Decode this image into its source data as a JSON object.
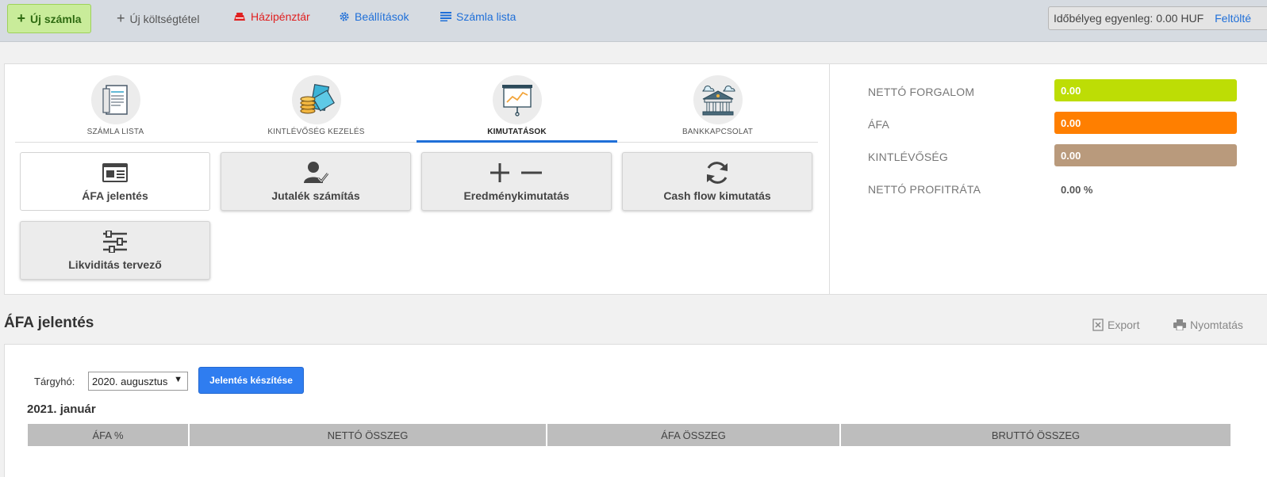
{
  "topbar": {
    "new_invoice": "Új számla",
    "new_cost": "Új költségtétel",
    "cashbox": "Házipénztár",
    "settings": "Beállítások",
    "invoice_list": "Számla lista",
    "balance": "Időbélyeg egyenleg: 0.00 HUF",
    "topup": "Feltölté"
  },
  "tabs": [
    {
      "label": "SZÁMLA LISTA",
      "icon": "invoice-list-icon"
    },
    {
      "label": "KINTLÉVŐSÉG KEZELÉS",
      "icon": "receivables-icon"
    },
    {
      "label": "KIMUTATÁSOK",
      "icon": "reports-icon",
      "active": true
    },
    {
      "label": "BANKKAPCSOLAT",
      "icon": "bank-icon"
    }
  ],
  "tiles": [
    {
      "label": "ÁFA jelentés",
      "icon": "newspaper-icon"
    },
    {
      "label": "Jutalék számítás",
      "icon": "user-check-icon"
    },
    {
      "label": "Eredménykimutatás",
      "icon": "plus-minus-icon"
    },
    {
      "label": "Cash flow kimutatás",
      "icon": "refresh-icon"
    },
    {
      "label": "Likviditás tervező",
      "icon": "sliders-icon"
    }
  ],
  "stats": [
    {
      "label": "NETTÓ FORGALOM",
      "value": "0.00",
      "color": "#bddd05"
    },
    {
      "label": "ÁFA",
      "value": "0.00",
      "color": "#ff7f00"
    },
    {
      "label": "KINTLÉVŐSÉG",
      "value": "0.00",
      "color": "#b99a7c"
    },
    {
      "label": "NETTÓ PROFITRÁTA",
      "value": "0.00 %"
    }
  ],
  "section": {
    "title": "ÁFA jelentés",
    "export": "Export",
    "print": "Nyomtatás"
  },
  "report": {
    "period_label": "Tárgyhó:",
    "period_value": "2020. augusztus",
    "generate_button": "Jelentés készítése",
    "year_title": "2021. január",
    "columns": [
      "ÁFA %",
      "NETTÓ ÖSSZEG",
      "ÁFA ÖSSZEG",
      "BRUTTÓ ÖSSZEG"
    ]
  }
}
